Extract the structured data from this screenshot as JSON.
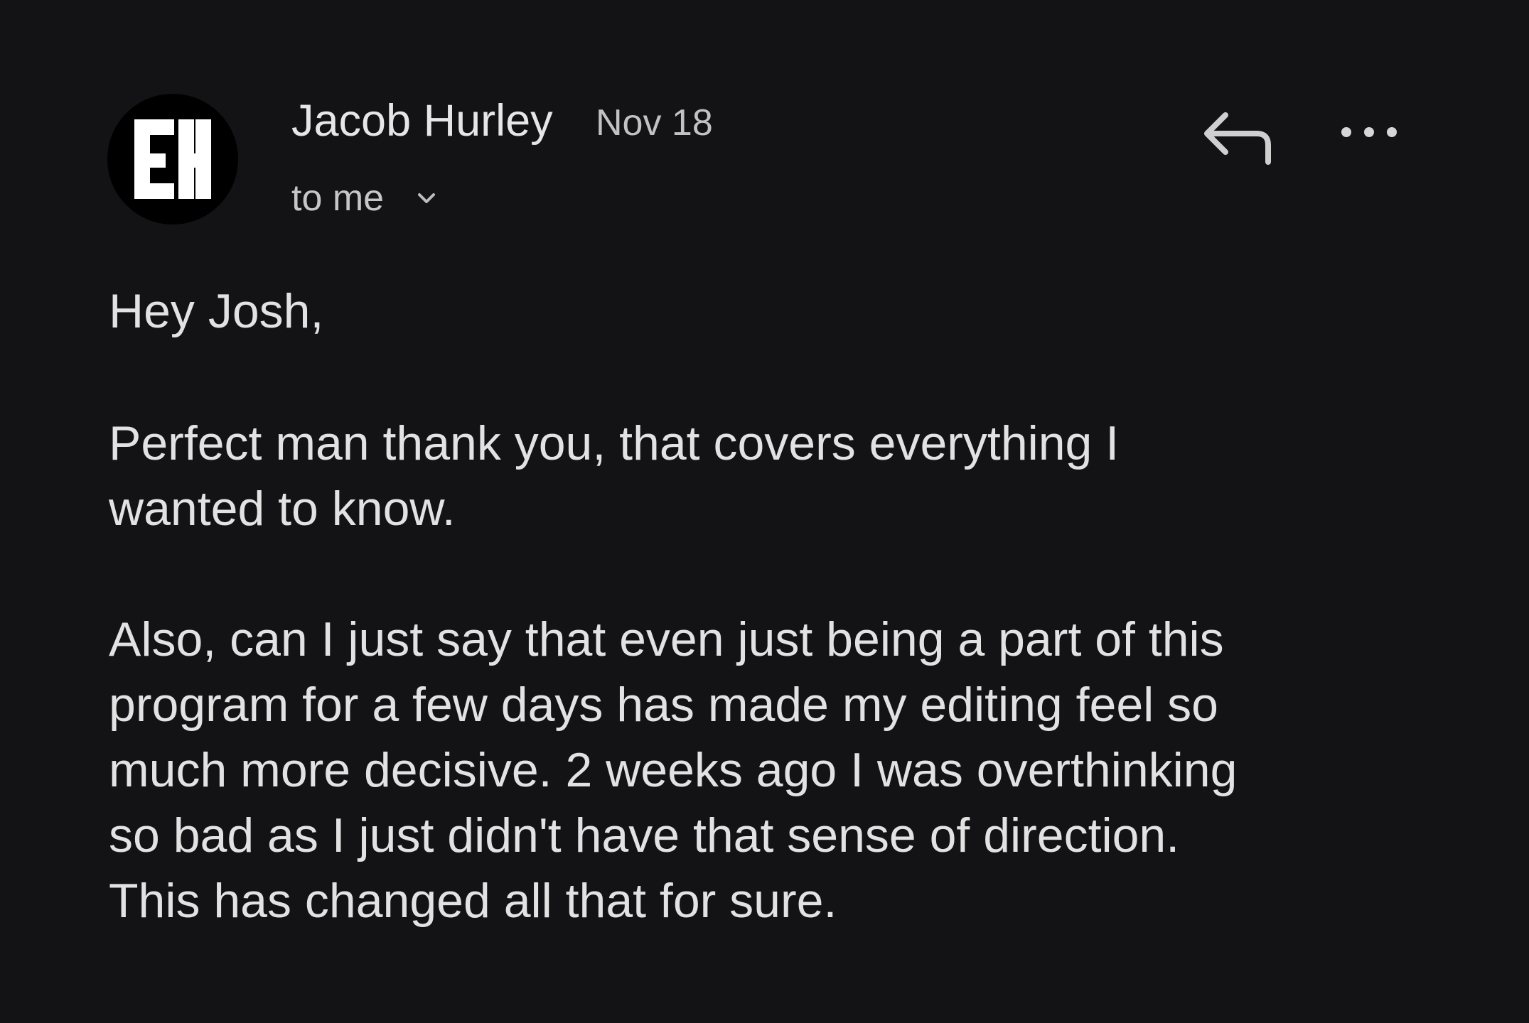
{
  "email": {
    "sender": {
      "name": "Jacob Hurley",
      "avatar_icon": "monogram-eh-logo"
    },
    "date": "Nov 18",
    "recipients_label": "to me",
    "actions": {
      "reply_icon": "reply-arrow-icon",
      "more_icon": "more-dots-icon",
      "expand_icon": "chevron-down-icon"
    },
    "body": {
      "greeting": "Hey Josh,",
      "paragraph1": [
        "Perfect man thank you, that covers everything I",
        "wanted to know."
      ],
      "paragraph2": [
        "Also, can I just say that even just being a part of this",
        "program for a few days has made my editing feel so",
        "much more decisive. 2 weeks ago I was overthinking",
        "so bad as I just didn't have that sense of direction.",
        "This has changed all that for sure."
      ]
    }
  },
  "colors": {
    "background": "#131215",
    "primary_text": "#e2e2e2",
    "secondary_text": "#c2c2c2",
    "avatar_bg": "#000000",
    "avatar_fg": "#ffffff"
  }
}
